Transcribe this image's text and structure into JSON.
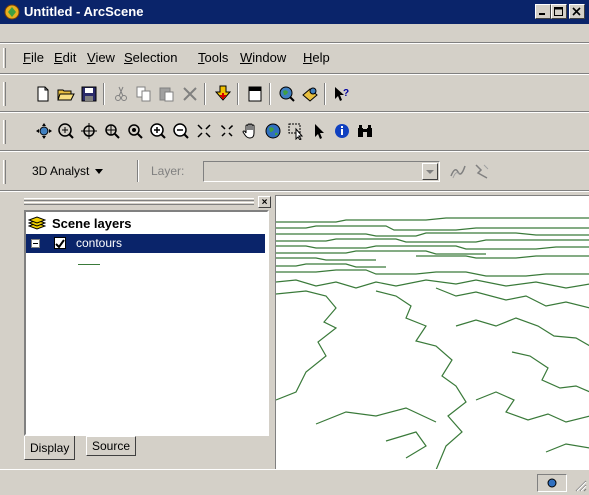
{
  "window": {
    "title": "Untitled - ArcScene"
  },
  "menu": {
    "items": [
      {
        "key": "F",
        "rest": "ile"
      },
      {
        "key": "E",
        "rest": "dit"
      },
      {
        "key": "V",
        "rest": "iew"
      },
      {
        "key": "S",
        "rest": "election"
      },
      {
        "key": "T",
        "rest": "ools"
      },
      {
        "key": "W",
        "rest": "indow"
      },
      {
        "key": "H",
        "rest": "elp"
      }
    ]
  },
  "analyst_toolbar": {
    "menu_label": "3D Analyst",
    "layer_label": "Layer:",
    "layer_value": ""
  },
  "toc": {
    "root_label": "Scene layers",
    "layer_name": "contours",
    "layer_checked": true,
    "tabs": [
      "Display",
      "Source"
    ],
    "active_tab": "Display"
  },
  "colors": {
    "title_bar": "#0a246a",
    "selection": "#0a246a",
    "contour_line": "#3a7a3a",
    "face": "#d4d0c8"
  }
}
